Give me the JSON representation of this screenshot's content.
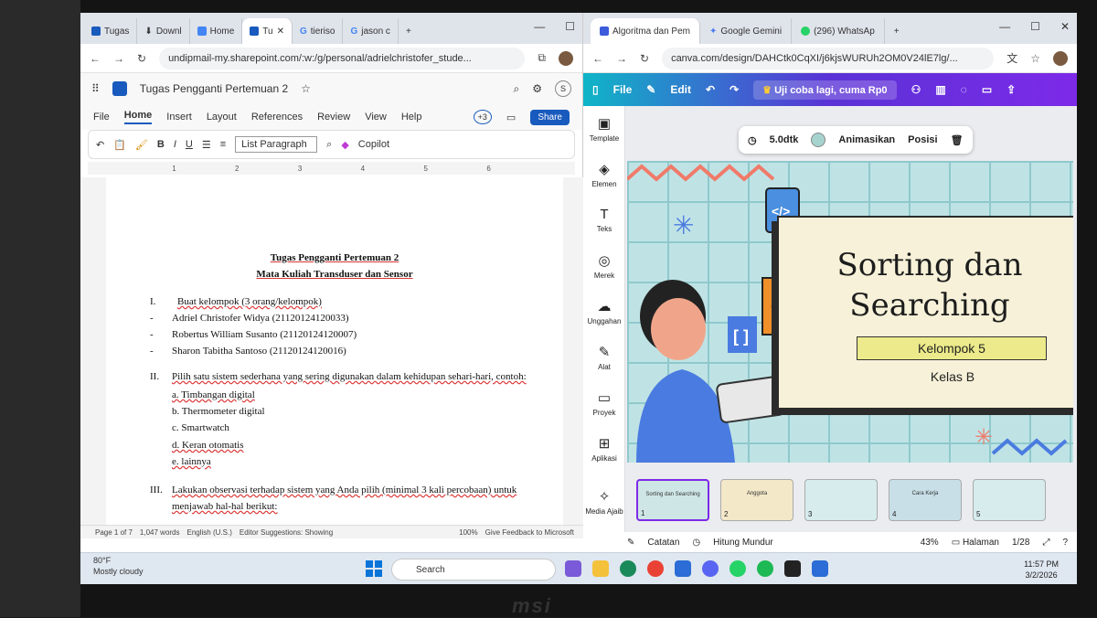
{
  "left_browser": {
    "tabs": [
      "Tugas",
      "Downl",
      "Home",
      "Tu",
      "tieriso",
      "jason c"
    ],
    "url": "undipmail-my.sharepoint.com/:w:/g/personal/adrielchristofer_stude...",
    "doc_title": "Tugas Pengganti Pertemuan 2",
    "menu": [
      "File",
      "Home",
      "Insert",
      "Layout",
      "References",
      "Review",
      "View",
      "Help"
    ],
    "active_menu": "Home",
    "share_label": "Share",
    "collab_count": "+3",
    "style_name": "List Paragraph",
    "copilot_label": "Copilot",
    "ruler_marks": [
      "1",
      "2",
      "3",
      "4",
      "5",
      "6"
    ]
  },
  "document": {
    "title1": "Tugas Pengganti Pertemuan 2",
    "title2": "Mata Kuliah Transduser dan Sensor",
    "sec1_num": "I.",
    "sec1_text": "Buat kelompok (3 orang/kelompok)",
    "members": [
      "Adriel Christofer Widya (21120124120033)",
      "Robertus William Susanto (21120124120007)",
      "Sharon Tabitha Santoso (21120124120016)"
    ],
    "sec2_num": "II.",
    "sec2_text": "Pilih satu sistem sederhana yang sering digunakan dalam kehidupan sehari-hari, contoh:",
    "options": [
      "a. Timbangan digital",
      "b. Thermometer digital",
      "c. Smartwatch",
      "d. Keran otomatis",
      "e. lainnya"
    ],
    "sec3_num": "III.",
    "sec3_text": "Lakukan observasi terhadap sistem yang Anda pilih (minimal 3 kali percobaan) untuk",
    "sec3_text2": "menjawab hal-hal berikut:"
  },
  "word_status": {
    "page": "Page 1 of 7",
    "words": "1,047 words",
    "lang": "English (U.S.)",
    "editor": "Editor Suggestions: Showing",
    "zoom": "100%",
    "feedback": "Give Feedback to Microsoft"
  },
  "right_browser": {
    "tabs": [
      "Algoritma dan Pem",
      "Google Gemini",
      "(296) WhatsAp"
    ],
    "url": "canva.com/design/DAHCtk0CqXI/j6kjsWURUh2OM0V24lE7lg/...",
    "file_label": "File",
    "edit_label": "Edit",
    "upgrade_label": "Uji coba lagi, cuma Rp0"
  },
  "canva": {
    "nav": [
      "Template",
      "Elemen",
      "Teks",
      "Merek",
      "Unggahan",
      "Alat",
      "Proyek",
      "Aplikasi",
      "Media Ajaib"
    ],
    "duration": "5.0dtk",
    "animate": "Animasikan",
    "position": "Posisi",
    "slide_title_1": "Sorting dan",
    "slide_title_2": "Searching",
    "group": "Kelompok 5",
    "kelas": "Kelas B",
    "thumb_numbers": [
      "1",
      "2",
      "3",
      "4",
      "5"
    ],
    "thumb1_title": "Sorting dan Searching",
    "thumb2_title": "Anggota",
    "thumb4_title": "Cara Kerja",
    "notes": "Catatan",
    "timer": "Hitung Mundur",
    "zoom": "43%",
    "pages_label": "Halaman",
    "page_count": "1/28",
    "accent": "#7d2ae8"
  },
  "taskbar": {
    "temp": "80°F",
    "weather": "Mostly cloudy",
    "search": "Search",
    "time": "11:57 PM",
    "date": "3/2/2026"
  },
  "brand": "msi"
}
